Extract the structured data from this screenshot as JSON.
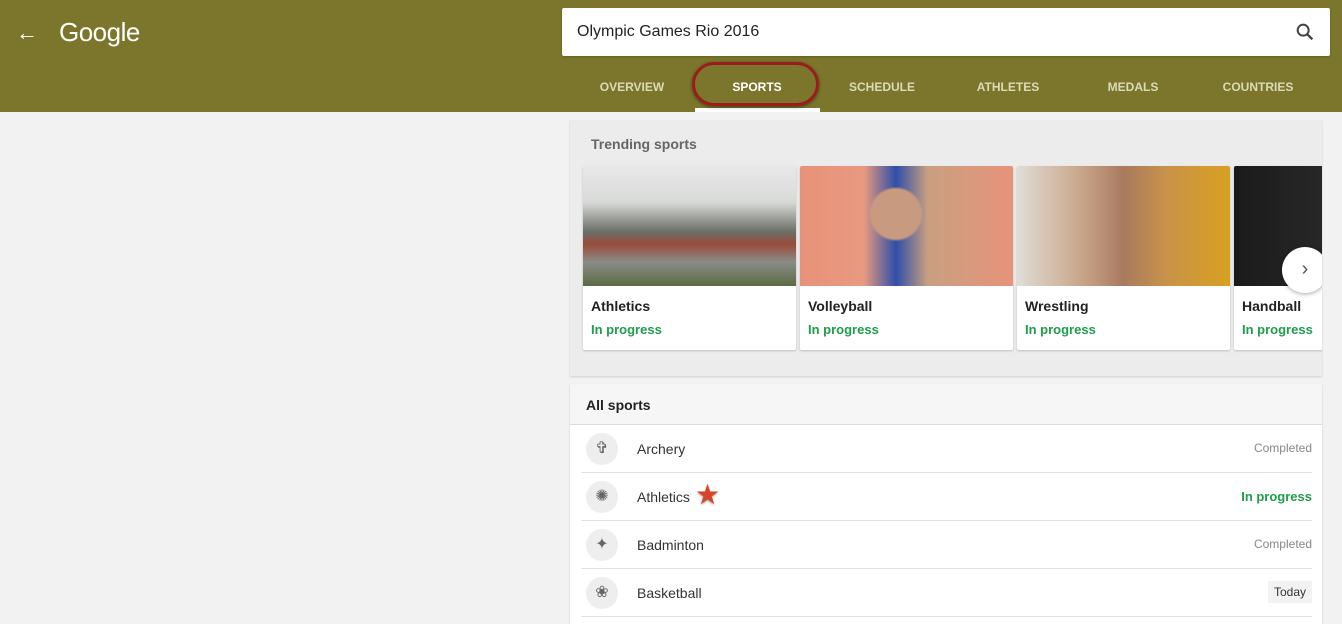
{
  "header": {
    "logo": "Google",
    "search_value": "Olympic Games Rio 2016"
  },
  "tabs": [
    "OVERVIEW",
    "SPORTS",
    "SCHEDULE",
    "ATHLETES",
    "MEDALS",
    "COUNTRIES"
  ],
  "trending": {
    "title": "Trending sports",
    "cards": [
      {
        "name": "Athletics",
        "status": "In progress"
      },
      {
        "name": "Volleyball",
        "status": "In progress"
      },
      {
        "name": "Wrestling",
        "status": "In progress"
      },
      {
        "name": "Handball",
        "status": "In progress"
      }
    ]
  },
  "all_sports": {
    "title": "All sports",
    "rows": [
      {
        "name": "Archery",
        "status": "Completed"
      },
      {
        "name": "Athletics",
        "status": "In progress"
      },
      {
        "name": "Badminton",
        "status": "Completed"
      },
      {
        "name": "Basketball",
        "status": "Today"
      }
    ]
  },
  "colors": {
    "header": "#7b762b",
    "green": "#1e9e4c",
    "ring": "#9b1c1c"
  }
}
